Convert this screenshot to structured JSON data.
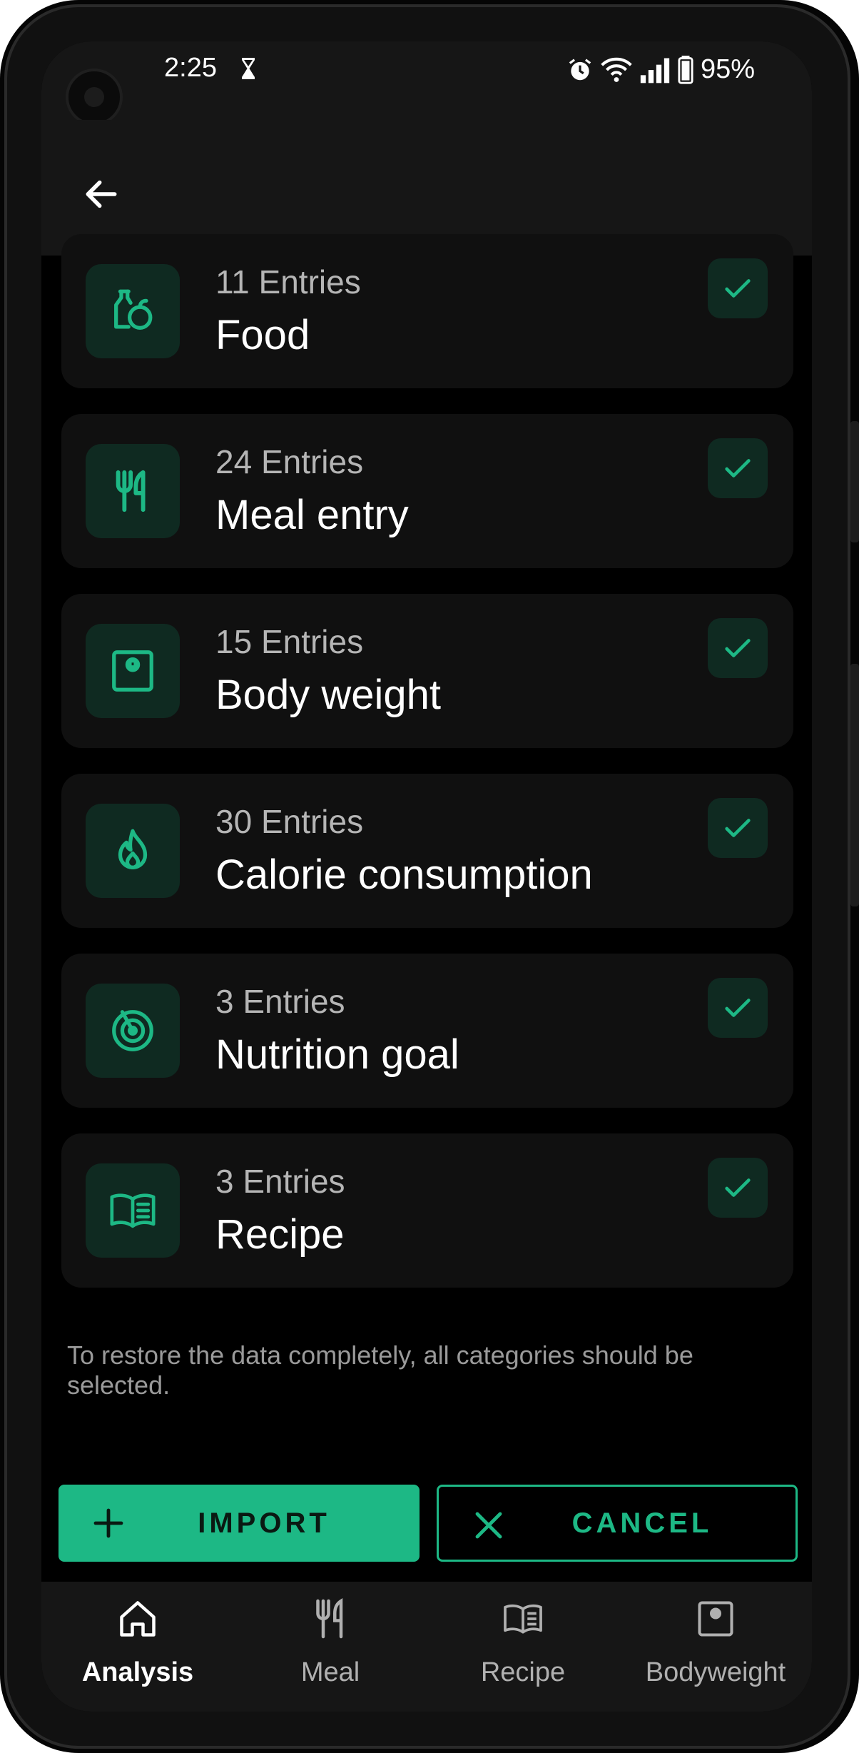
{
  "status": {
    "time": "2:25",
    "battery": "95%"
  },
  "categories": [
    {
      "entries": "11 Entries",
      "name": "Food",
      "icon": "food-icon",
      "checked": true
    },
    {
      "entries": "24 Entries",
      "name": "Meal entry",
      "icon": "cutlery-icon",
      "checked": true
    },
    {
      "entries": "15 Entries",
      "name": "Body weight",
      "icon": "scale-icon",
      "checked": true
    },
    {
      "entries": "30 Entries",
      "name": "Calorie consumption",
      "icon": "flame-icon",
      "checked": true
    },
    {
      "entries": "3 Entries",
      "name": "Nutrition goal",
      "icon": "target-icon",
      "checked": true
    },
    {
      "entries": "3 Entries",
      "name": "Recipe",
      "icon": "book-icon",
      "checked": true
    }
  ],
  "note": "To restore the data completely, all categories should be selected.",
  "actions": {
    "import_label": "IMPORT",
    "cancel_label": "CANCEL"
  },
  "nav": [
    {
      "label": "Analysis",
      "icon": "home-icon",
      "active": true
    },
    {
      "label": "Meal",
      "icon": "cutlery-icon",
      "active": false
    },
    {
      "label": "Recipe",
      "icon": "book-icon",
      "active": false
    },
    {
      "label": "Bodyweight",
      "icon": "scale-icon",
      "active": false
    }
  ],
  "colors": {
    "accent": "#1db885",
    "icon_bg": "#0f2a21",
    "card": "#101010",
    "surface": "#161616"
  }
}
